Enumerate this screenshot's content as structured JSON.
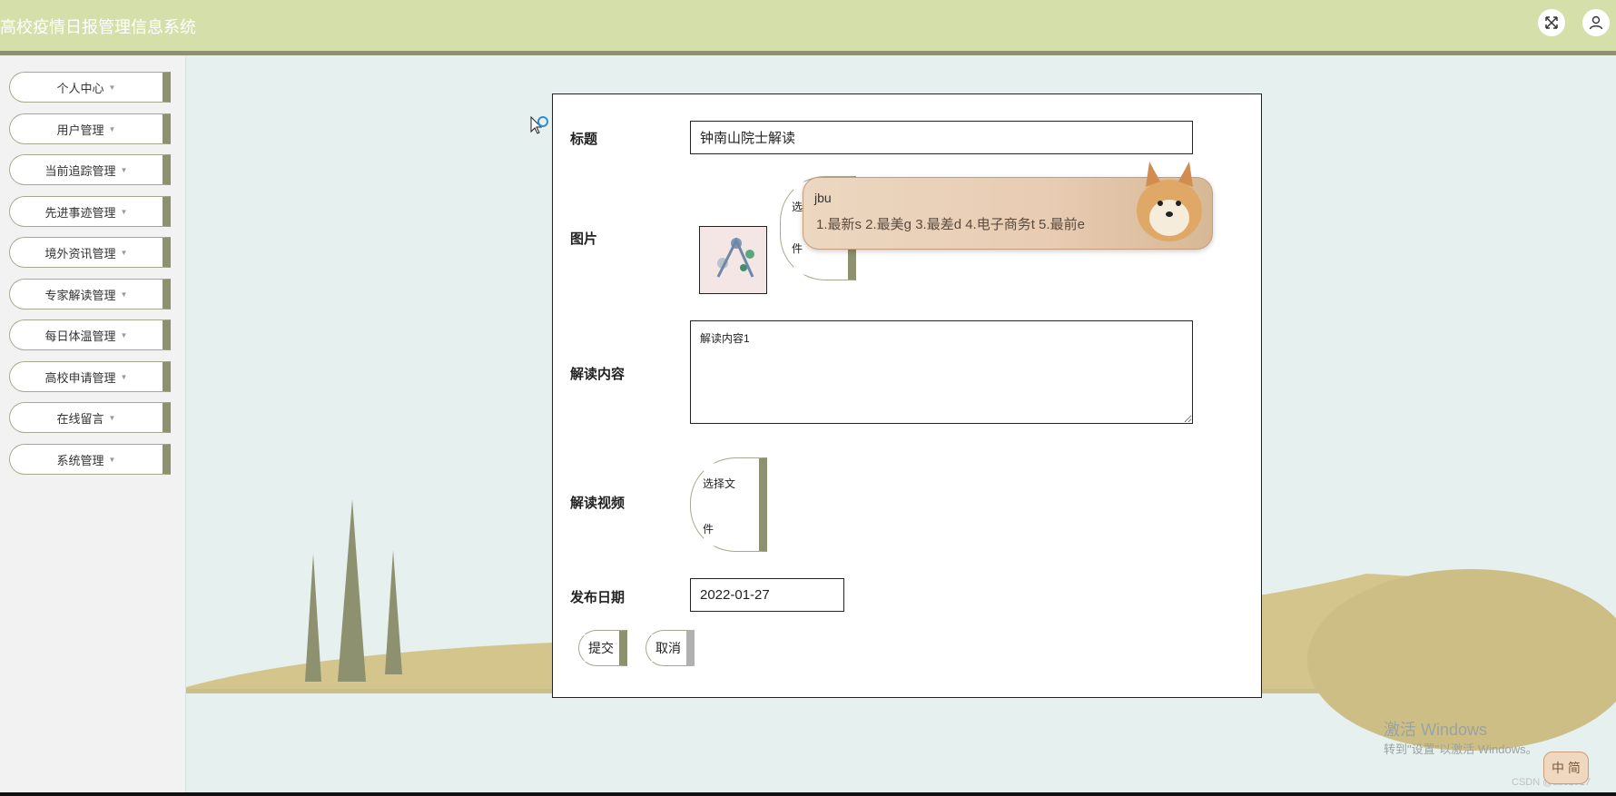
{
  "app": {
    "title": "高校疫情日报管理信息系统"
  },
  "header": {
    "icons": [
      "fullscreen-icon",
      "user-icon"
    ]
  },
  "sidebar": {
    "items": [
      {
        "label": "个人中心"
      },
      {
        "label": "用户管理"
      },
      {
        "label": "当前追踪管理"
      },
      {
        "label": "先进事迹管理"
      },
      {
        "label": "境外资讯管理"
      },
      {
        "label": "专家解读管理"
      },
      {
        "label": "每日体温管理"
      },
      {
        "label": "高校申请管理"
      },
      {
        "label": "在线留言"
      },
      {
        "label": "系统管理"
      }
    ]
  },
  "form": {
    "title_label": "标题",
    "title_value": "钟南山院士解读",
    "image_label": "图片",
    "image_file_button": "选择文件",
    "image_file_button_visible": "选",
    "image_file_button_line2": "件",
    "content_label": "解读内容",
    "content_value": "解读内容1",
    "video_label": "解读视频",
    "video_file_button_line1": "选择文",
    "video_file_button_line2": "件",
    "date_label": "发布日期",
    "date_value": "2022-01-27",
    "submit_label": "提交",
    "cancel_label": "取消"
  },
  "ime": {
    "composition": "jbu",
    "candidates": "1.最新s  2.最美g  3.最差d  4.电子商务t  5.最前e"
  },
  "watermark": {
    "activate_title": "激活 Windows",
    "activate_sub": "转到\"设置\"以激活 Windows。",
    "csdn": "CSDN @ass1917",
    "ime_mode": "中 简"
  },
  "colors": {
    "header_bg": "#d4dfaa",
    "accent": "#8d916f",
    "page_bg": "#e6f0ee",
    "ground": "#d3c58c"
  }
}
